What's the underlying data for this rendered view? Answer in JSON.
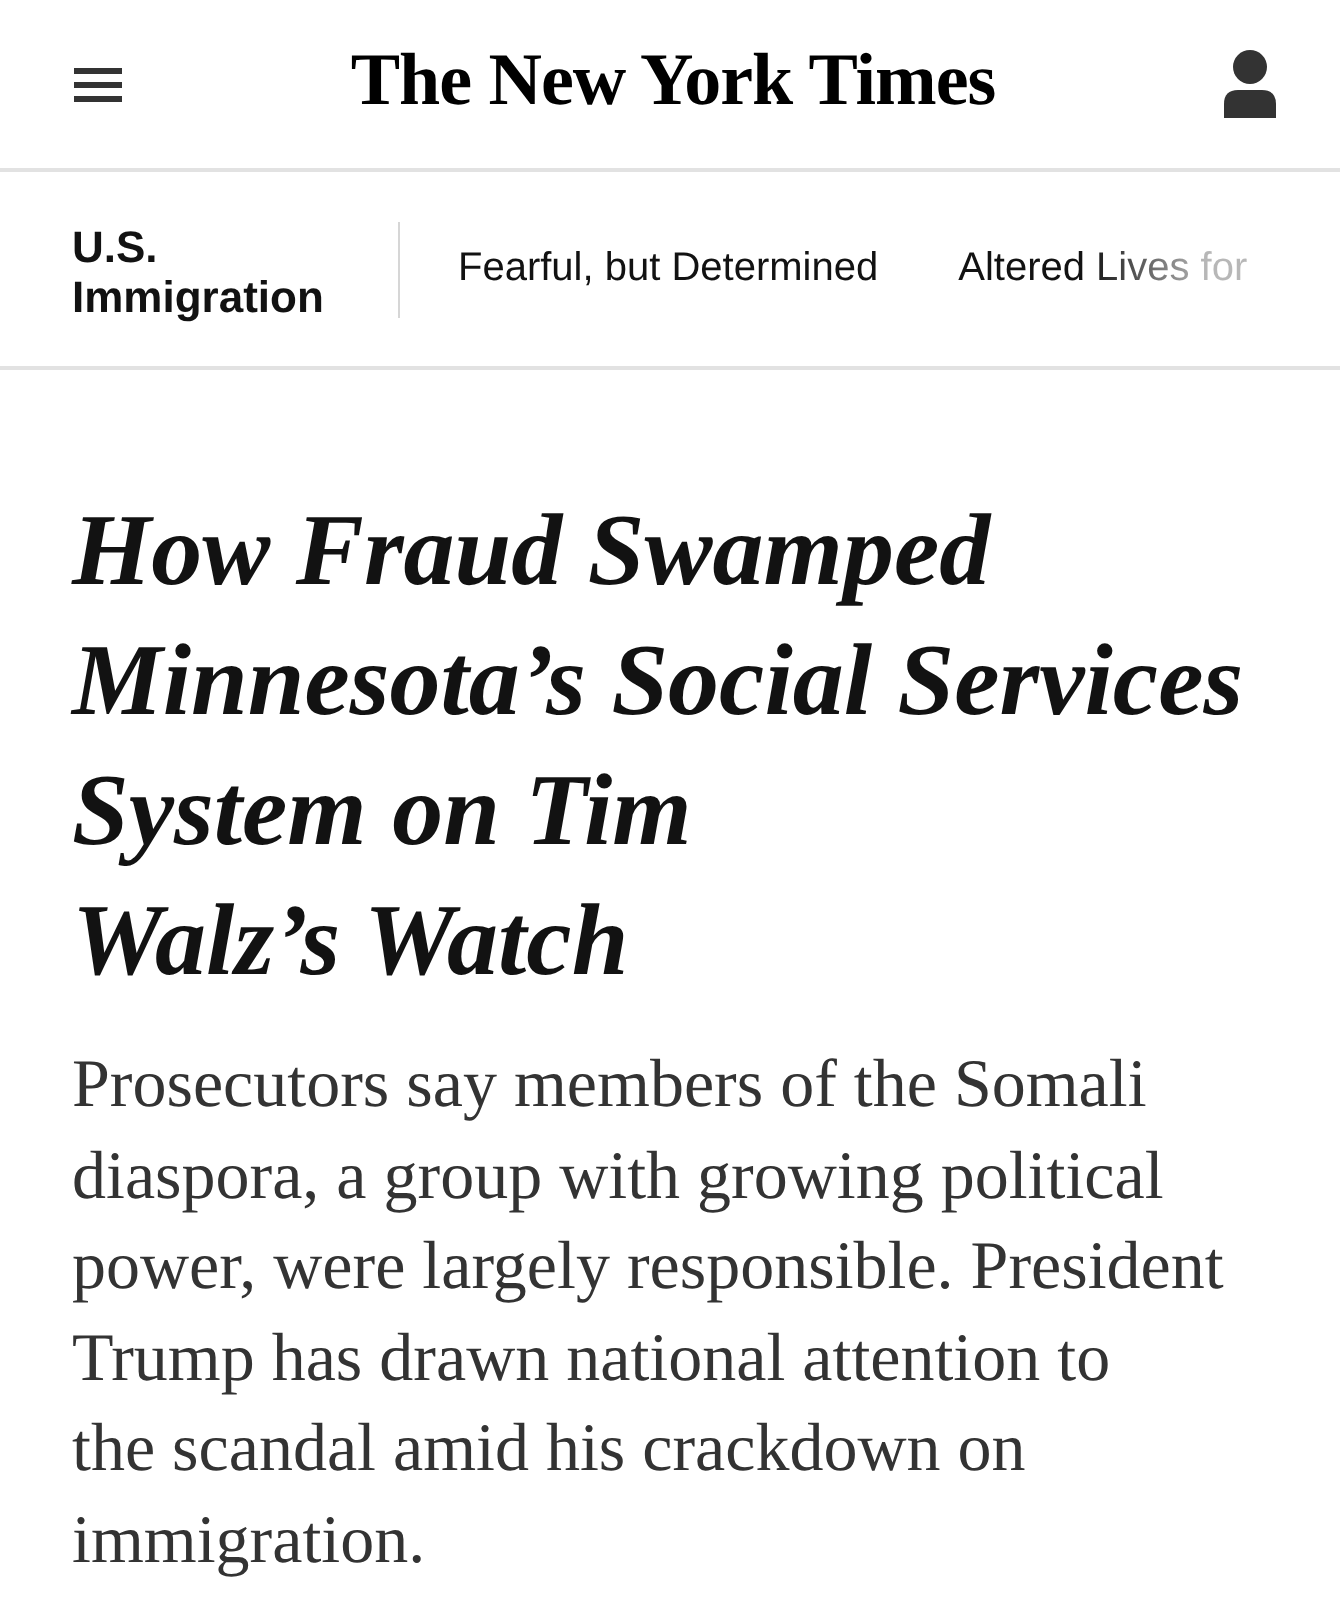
{
  "header": {
    "logo": "The New York Times"
  },
  "section_nav": {
    "section": "U.S. Immigration",
    "links": [
      {
        "label": "Fearful, but Determined",
        "faded": false
      },
      {
        "label": "Altered Lives for",
        "faded": true
      }
    ]
  },
  "article": {
    "headline": "How Fraud Swamped\nMinnesota’s Social Services\nSystem on Tim\nWalz’s Watch",
    "summary": "Prosecutors say members of the Somali\ndiaspora, a group with growing political\npower, were largely responsible. President\nTrump has drawn national attention to\nthe scandal amid his crackdown on\nimmigration."
  }
}
